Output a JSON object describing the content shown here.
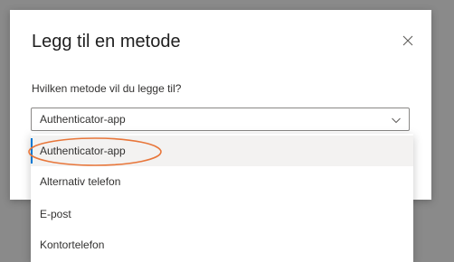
{
  "dialog": {
    "title": "Legg til en metode",
    "close_icon": "close-icon",
    "prompt": "Hvilken metode vil du legge til?"
  },
  "select": {
    "value": "Authenticator-app",
    "chevron_icon": "chevron-down-icon"
  },
  "dropdown": {
    "options": [
      {
        "label": "Authenticator-app",
        "selected": true
      },
      {
        "label": "Alternativ telefon",
        "selected": false
      },
      {
        "label": "E-post",
        "selected": false
      },
      {
        "label": "Kontortelefon",
        "selected": false
      }
    ]
  },
  "colors": {
    "accent": "#0078d4",
    "annotation_ellipse": "#e8763a",
    "backdrop": "#8a8a8a",
    "selected_option_bg": "#f3f2f1"
  }
}
